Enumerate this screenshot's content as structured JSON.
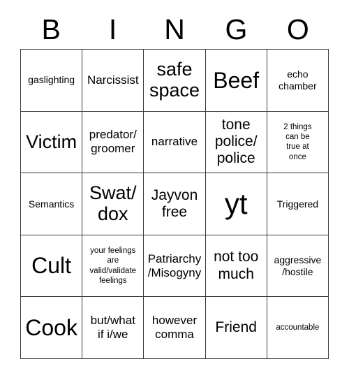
{
  "header": {
    "letters": [
      "B",
      "I",
      "N",
      "G",
      "O"
    ]
  },
  "grid": {
    "rows": 5,
    "columns": 5,
    "border_color": "#3a3a3a",
    "cell_background": "#ffffff",
    "text_color": "#000000",
    "cells": [
      {
        "text": "gaslighting",
        "size": "xs"
      },
      {
        "text": "Narcissist",
        "size": "sm"
      },
      {
        "text": "safe\nspace",
        "size": "lg"
      },
      {
        "text": "Beef",
        "size": "xl"
      },
      {
        "text": "echo\nchamber",
        "size": "xs"
      },
      {
        "text": "Victim",
        "size": "lg"
      },
      {
        "text": "predator/\ngroomer",
        "size": "sm"
      },
      {
        "text": "narrative",
        "size": "sm"
      },
      {
        "text": "tone\npolice/\npolice",
        "size": "md"
      },
      {
        "text": "2 things\ncan be\ntrue at\nonce",
        "size": "xxs"
      },
      {
        "text": "Semantics",
        "size": "xs"
      },
      {
        "text": "Swat/\ndox",
        "size": "lg"
      },
      {
        "text": "Jayvon\nfree",
        "size": "md"
      },
      {
        "text": "yt",
        "size": "xxl"
      },
      {
        "text": "Triggered",
        "size": "xs"
      },
      {
        "text": "Cult",
        "size": "xl"
      },
      {
        "text": "your feelings\nare\nvalid/validate\nfeelings",
        "size": "xxs"
      },
      {
        "text": "Patriarchy\n/Misogyny",
        "size": "sm"
      },
      {
        "text": "not too\nmuch",
        "size": "md"
      },
      {
        "text": "aggressive\n/hostile",
        "size": "xs"
      },
      {
        "text": "Cook",
        "size": "xl"
      },
      {
        "text": "but/what\nif i/we",
        "size": "sm"
      },
      {
        "text": "however\ncomma",
        "size": "sm"
      },
      {
        "text": "Friend",
        "size": "md"
      },
      {
        "text": "accountable",
        "size": "xxs"
      }
    ]
  }
}
